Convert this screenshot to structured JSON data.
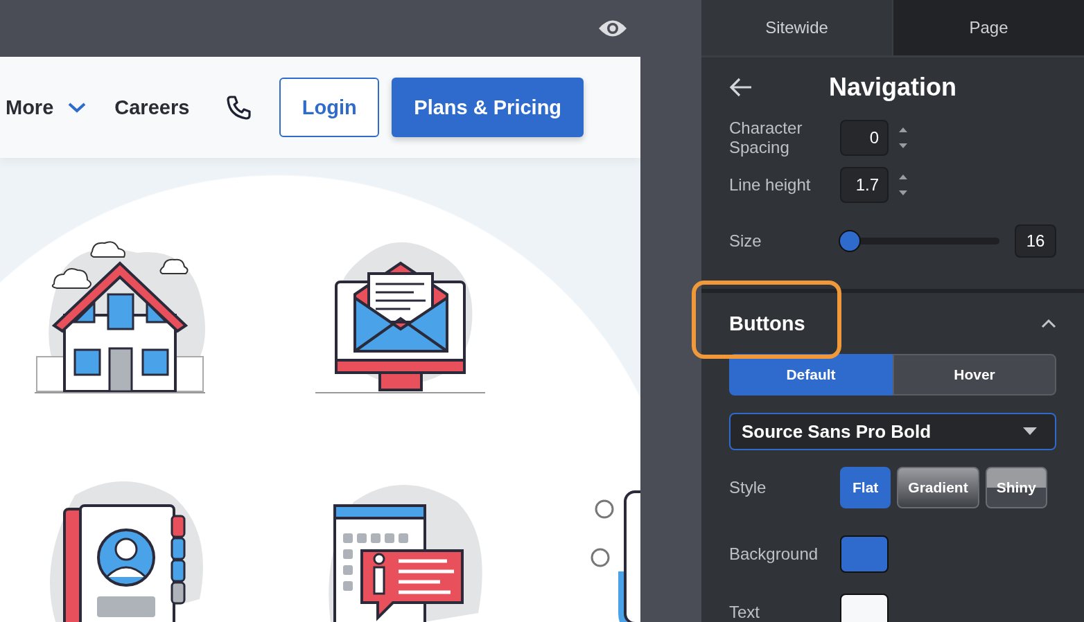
{
  "site_nav": {
    "links": [
      {
        "label": "More",
        "kind": "dropdown"
      },
      {
        "label": "Careers",
        "kind": "link"
      }
    ],
    "login": "Login",
    "cta": "Plans & Pricing"
  },
  "illustration_rows": [
    [
      {
        "kind": "house"
      },
      {
        "kind": "mail"
      }
    ],
    [
      {
        "kind": "contact"
      },
      {
        "kind": "info"
      },
      {
        "kind": "partial"
      }
    ]
  ],
  "panel": {
    "tabs": [
      {
        "label": "Sitewide",
        "selected": true
      },
      {
        "label": "Page",
        "selected": false
      }
    ],
    "title": "Navigation",
    "typography": [
      {
        "kind": "stepper",
        "label": "Character Spacing",
        "value": "0"
      },
      {
        "kind": "stepper",
        "label": "Line height",
        "value": "1.7"
      },
      {
        "kind": "slider",
        "label": "Size",
        "level": 0,
        "value": "16"
      }
    ],
    "section": {
      "title": "Buttons",
      "expanded": true,
      "highlighted": true
    },
    "states": [
      {
        "label": "Default",
        "selected": true
      },
      {
        "label": "Hover",
        "selected": false
      }
    ],
    "font": "Source Sans Pro Bold",
    "style": {
      "label": "Style",
      "options": [
        {
          "label": "Flat",
          "kind": "flat",
          "selected": true
        },
        {
          "label": "Gradient",
          "kind": "gradient",
          "selected": false
        },
        {
          "label": "Shiny",
          "kind": "shiny",
          "selected": false
        }
      ]
    },
    "colors": [
      {
        "label": "Background",
        "color": "#2f6bcc"
      },
      {
        "label": "Text",
        "color": "#f7f8fa"
      }
    ]
  }
}
